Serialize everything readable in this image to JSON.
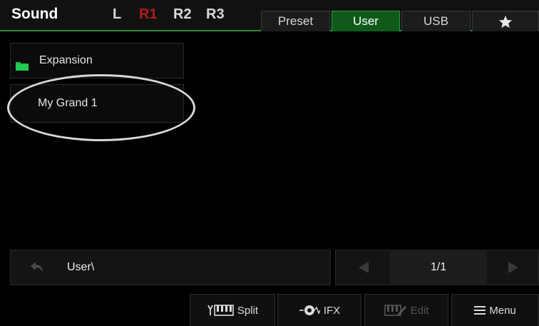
{
  "header": {
    "title": "Sound",
    "parts": [
      {
        "label": "L",
        "active": false
      },
      {
        "label": "R1",
        "active": true
      },
      {
        "label": "R2",
        "active": false
      },
      {
        "label": "R3",
        "active": false
      }
    ],
    "tabs": [
      {
        "label": "Preset",
        "active": false
      },
      {
        "label": "User",
        "active": true
      },
      {
        "label": "USB",
        "active": false
      },
      {
        "icon": "star-icon",
        "active": false
      }
    ],
    "accent_color": "#2f8a3a",
    "active_part_color": "#b31b1b"
  },
  "list": {
    "items": [
      {
        "label": "Expansion",
        "icon": "folder-icon",
        "icon_color": "#1fb84a"
      },
      {
        "label": "My Grand 1"
      }
    ]
  },
  "pathbar": {
    "back_icon": "back-arrow-icon",
    "path": "User\\"
  },
  "pager": {
    "page": "1/1",
    "prev_icon": "triangle-left-icon",
    "next_icon": "triangle-right-icon"
  },
  "bottom": {
    "split": {
      "label": "Split",
      "icon": "keyboard-split-icon"
    },
    "ifx": {
      "label": "IFX",
      "icon": "knob-icon"
    },
    "edit": {
      "label": "Edit",
      "icon": "keyboard-edit-icon",
      "enabled": false
    },
    "menu": {
      "label": "Menu",
      "icon": "hamburger-icon"
    }
  }
}
